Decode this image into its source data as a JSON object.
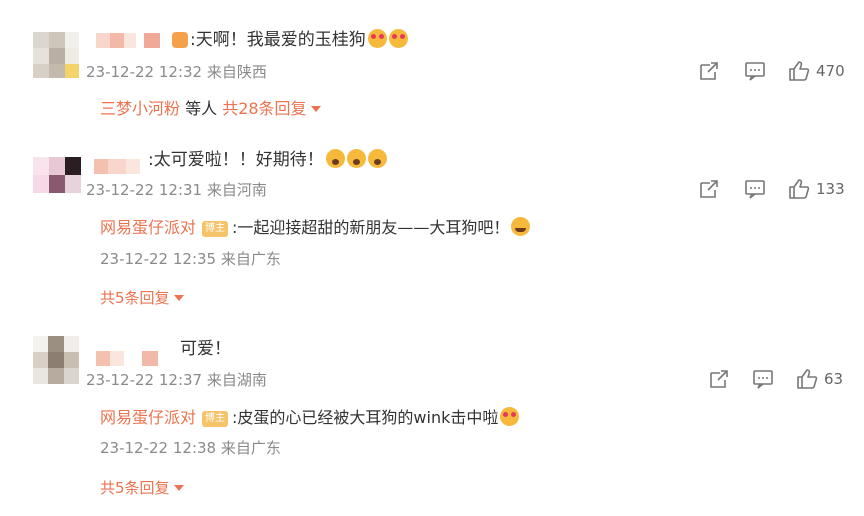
{
  "comments": [
    {
      "text": ":天啊！我最爱的玉桂狗",
      "time": "23-12-22 12:32 来自陕西",
      "likes": "470",
      "replies_summary": {
        "user": "三梦小河粉",
        "mid": " 等人",
        "count_text": " 共28条回复"
      }
    },
    {
      "text": ":太可爱啦！！好期待！",
      "time": "23-12-22 12:31 来自河南",
      "likes": "133",
      "reply": {
        "user": "网易蛋仔派对",
        "badge": "博主",
        "text": ":一起迎接超甜的新朋友——大耳狗吧！",
        "time": "23-12-22 12:35 来自广东"
      },
      "more_replies": "共5条回复"
    },
    {
      "text": "可爱！",
      "time": "23-12-22 12:37 来自湖南",
      "likes": "63",
      "reply": {
        "user": "网易蛋仔派对",
        "badge": "博主",
        "text": ":皮蛋的心已经被大耳狗的wink击中啦",
        "time": "23-12-22 12:38 来自广东"
      },
      "more_replies": "共5条回复"
    }
  ],
  "icons": {
    "share": "share-icon",
    "comment": "comment-icon",
    "like": "thumbs-up-icon"
  },
  "colors": {
    "link": "#eb7350",
    "meta": "#8a8a8a",
    "badge": "#f6c36a"
  }
}
